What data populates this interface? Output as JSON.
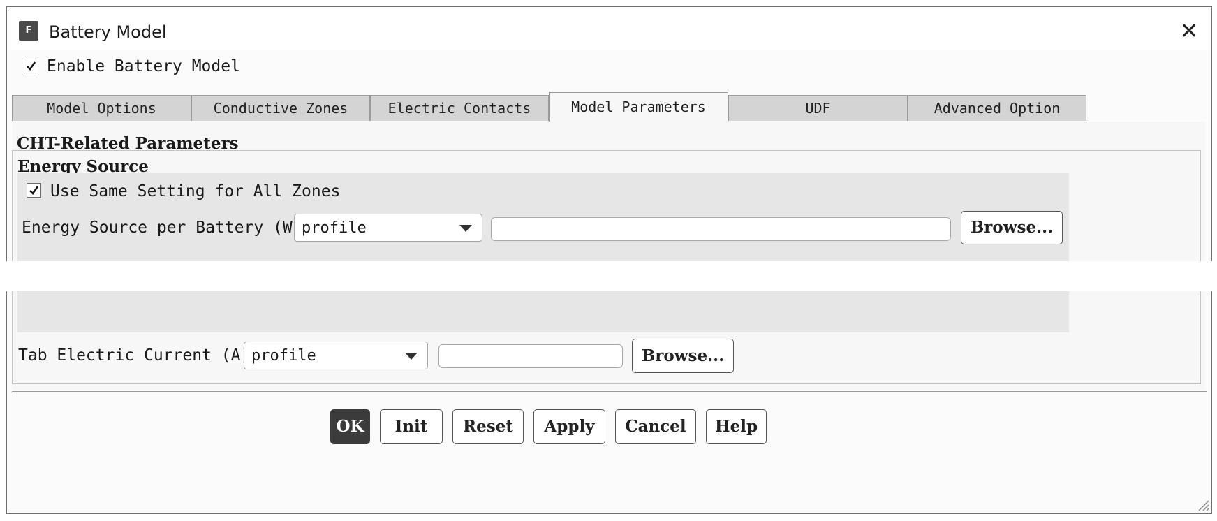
{
  "window": {
    "title": "Battery Model",
    "icon_letter": "F",
    "close_label": "✕"
  },
  "enable_checkbox": {
    "label": "Enable Battery Model",
    "checked": true
  },
  "tabs": [
    {
      "label": "Model Options",
      "active": false
    },
    {
      "label": "Conductive Zones",
      "active": false
    },
    {
      "label": "Electric Contacts",
      "active": false
    },
    {
      "label": "Model Parameters",
      "active": true
    },
    {
      "label": "UDF",
      "active": false
    },
    {
      "label": "Advanced Option",
      "active": false
    }
  ],
  "cht": {
    "title": "CHT-Related Parameters",
    "energy_source": {
      "title": "Energy Source",
      "same_setting": {
        "label": "Use Same Setting for All Zones",
        "checked": true
      },
      "per_battery": {
        "label": "Energy Source per Battery (W)",
        "select_value": "profile",
        "text_value": "",
        "browse_label": "Browse..."
      }
    },
    "tab_current": {
      "label": "Tab Electric Current (A)",
      "select_value": "profile",
      "text_value": "",
      "browse_label": "Browse..."
    }
  },
  "footer": {
    "ok": "OK",
    "init": "Init",
    "reset": "Reset",
    "apply": "Apply",
    "cancel": "Cancel",
    "help": "Help"
  },
  "colors": {
    "primary_button": "#3b3b3b",
    "active_tab": "#f7f7f7",
    "inactive_tab": "#d4d4d4"
  }
}
